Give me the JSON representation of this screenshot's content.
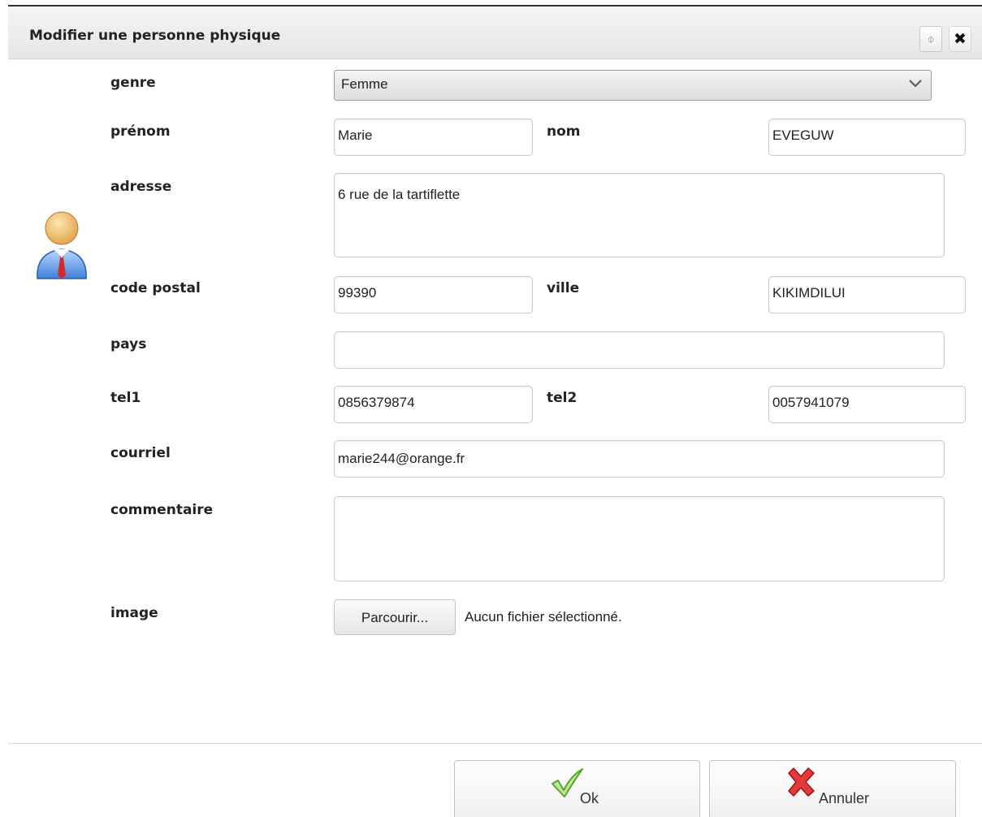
{
  "dialog": {
    "title": "Modifier une personne physique",
    "refresh_icon": "refresh-icon",
    "close_icon": "close-icon"
  },
  "avatar_icon": "user-avatar-icon",
  "form": {
    "genre": {
      "label": "genre",
      "value": "Femme"
    },
    "prenom": {
      "label": "prénom",
      "value": "Marie"
    },
    "nom": {
      "label": "nom",
      "value": "EVEGUW"
    },
    "adresse": {
      "label": "adresse",
      "value": "6 rue de la tartiflette"
    },
    "code_postal": {
      "label": "code postal",
      "value": "99390"
    },
    "ville": {
      "label": "ville",
      "value": "KIKIMDILUI"
    },
    "pays": {
      "label": "pays",
      "value": ""
    },
    "tel1": {
      "label": "tel1",
      "value": "0856379874"
    },
    "tel2": {
      "label": "tel2",
      "value": "0057941079"
    },
    "courriel": {
      "label": "courriel",
      "value": "marie244@orange.fr"
    },
    "commentaire": {
      "label": "commentaire",
      "value": ""
    },
    "image": {
      "label": "image",
      "button": "Parcourir...",
      "status": "Aucun fichier sélectionné."
    }
  },
  "actions": {
    "ok": "Ok",
    "cancel": "Annuler"
  },
  "colors": {
    "ok_check": "#6fc43a",
    "cancel_x": "#d0262d"
  }
}
